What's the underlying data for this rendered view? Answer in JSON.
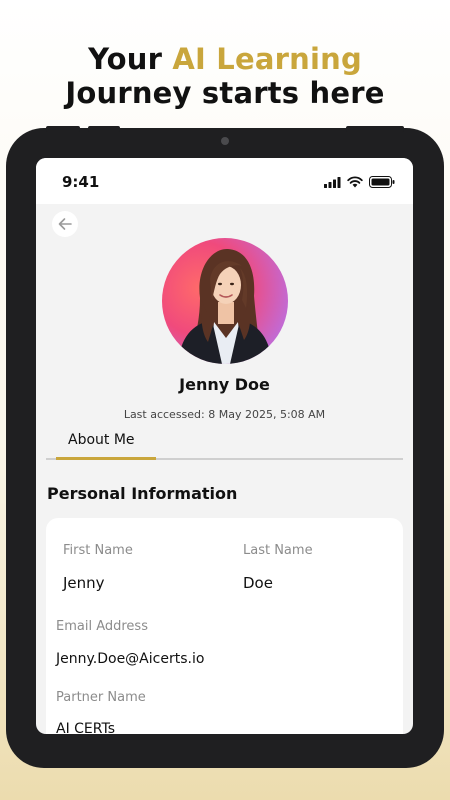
{
  "headline": {
    "line1_prefix": "Your ",
    "line1_accent": "AI Learning",
    "line2": "Journey starts here"
  },
  "status_bar": {
    "time": "9:41",
    "icons": [
      "signal-icon",
      "wifi-icon",
      "battery-icon"
    ]
  },
  "profile": {
    "name": "Jenny Doe",
    "last_accessed": "Last accessed: 8 May 2025, 5:08 AM"
  },
  "tabs": [
    {
      "label": "About Me",
      "active": true
    }
  ],
  "personal_info": {
    "title": "Personal Information",
    "first_name_label": "First Name",
    "first_name_value": "Jenny",
    "last_name_label": "Last Name",
    "last_name_value": "Doe",
    "email_label": "Email Address",
    "email_value": "Jenny.Doe@Aicerts.io",
    "partner_label": "Partner Name",
    "partner_value": "AI CERTs"
  },
  "colors": {
    "accent": "#c9a63c",
    "device": "#1f1f21",
    "label_gray": "#8c8c8c"
  }
}
